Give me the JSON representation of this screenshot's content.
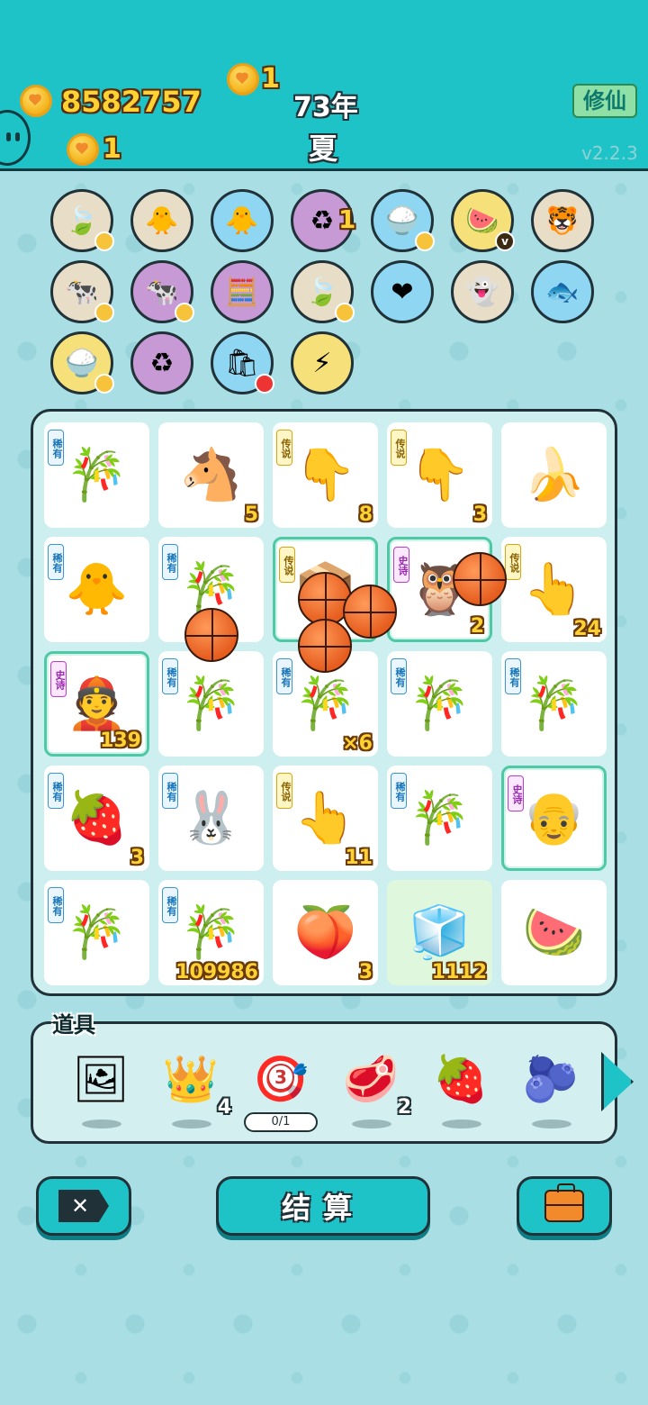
{
  "header": {
    "coins_total": "8582757",
    "coin_small_1": "1",
    "coin_small_2": "1",
    "year": "73年",
    "season": "夏",
    "xiuxian_label": "修仙",
    "version": "v2.2.3"
  },
  "skills": [
    {
      "name": "leaf-skill",
      "icon": "🍃",
      "bg": "#e8ddc6",
      "badge": "gold"
    },
    {
      "name": "chick-egg-skill",
      "icon": "🐥",
      "bg": "#e8ddc6",
      "badge": ""
    },
    {
      "name": "chick-egg-skill-2",
      "icon": "🐥",
      "bg": "#8fd6f2",
      "badge": ""
    },
    {
      "name": "recycle-coin-skill",
      "icon": "♻",
      "bg": "#c79ad6",
      "badge": "",
      "coin": "1"
    },
    {
      "name": "rice-bowl-skill",
      "icon": "🍚",
      "bg": "#8fd6f2",
      "badge": "gold"
    },
    {
      "name": "fruit-basket-skill",
      "icon": "🍉",
      "bg": "#f6e07a",
      "badge": "v"
    },
    {
      "name": "tiger-skill",
      "icon": "🐯",
      "bg": "#e8ddc6",
      "badge": ""
    },
    {
      "name": "cow-pair-skill",
      "icon": "🐄",
      "bg": "#e8ddc6",
      "badge": "gold"
    },
    {
      "name": "cow-pair-skill-2",
      "icon": "🐄",
      "bg": "#c79ad6",
      "badge": "gold"
    },
    {
      "name": "math-man-skill",
      "icon": "🧮",
      "bg": "#c79ad6",
      "badge": ""
    },
    {
      "name": "leaf-skill-2",
      "icon": "🍃",
      "bg": "#e8ddc6",
      "badge": "gold"
    },
    {
      "name": "heart-fan-skill",
      "icon": "❤",
      "bg": "#8fd6f2",
      "badge": ""
    },
    {
      "name": "ghost-skill",
      "icon": "👻",
      "bg": "#e8ddc6",
      "badge": ""
    },
    {
      "name": "fish-tank-skill",
      "icon": "🐟",
      "bg": "#8fd6f2",
      "badge": ""
    },
    {
      "name": "rice-bowl-skill-2",
      "icon": "🍚",
      "bg": "#f6e07a",
      "badge": "gold"
    },
    {
      "name": "recycle-skill",
      "icon": "♻",
      "bg": "#c79ad6",
      "badge": ""
    },
    {
      "name": "sack-skill",
      "icon": "🛍",
      "bg": "#8fd6f2",
      "badge": "red"
    },
    {
      "name": "lightning-skill",
      "icon": "⚡",
      "bg": "#f6e07a",
      "badge": ""
    }
  ],
  "board": [
    {
      "icon": "🎋",
      "tag": "稀有",
      "tagType": "rare",
      "count": ""
    },
    {
      "icon": "🐴",
      "tag": "",
      "tagType": "",
      "count": "5"
    },
    {
      "icon": "👇",
      "tag": "传说",
      "tagType": "legend",
      "count": "8"
    },
    {
      "icon": "👇",
      "tag": "传说",
      "tagType": "legend",
      "count": "3"
    },
    {
      "icon": "🍌",
      "tag": "",
      "tagType": "",
      "count": ""
    },
    {
      "icon": "🐥",
      "tag": "稀有",
      "tagType": "rare",
      "count": ""
    },
    {
      "icon": "🎋",
      "tag": "稀有",
      "tagType": "rare",
      "count": ""
    },
    {
      "icon": "📦",
      "tag": "传说",
      "tagType": "legend",
      "count": "",
      "hl": true
    },
    {
      "icon": "🦉",
      "tag": "史诗",
      "tagType": "epic",
      "count": "2",
      "hl": true
    },
    {
      "icon": "👆",
      "tag": "传说",
      "tagType": "legend",
      "count": "24"
    },
    {
      "icon": "👲",
      "tag": "史诗",
      "tagType": "epic",
      "count": "139",
      "hl": true
    },
    {
      "icon": "🎋",
      "tag": "稀有",
      "tagType": "rare",
      "count": ""
    },
    {
      "icon": "🎋",
      "tag": "稀有",
      "tagType": "rare",
      "count": "×6"
    },
    {
      "icon": "🎋",
      "tag": "稀有",
      "tagType": "rare",
      "count": ""
    },
    {
      "icon": "🎋",
      "tag": "稀有",
      "tagType": "rare",
      "count": ""
    },
    {
      "icon": "🍓",
      "tag": "稀有",
      "tagType": "rare",
      "count": "3"
    },
    {
      "icon": "🐰",
      "tag": "稀有",
      "tagType": "rare",
      "count": ""
    },
    {
      "icon": "👆",
      "tag": "传说",
      "tagType": "legend",
      "count": "11"
    },
    {
      "icon": "🎋",
      "tag": "稀有",
      "tagType": "rare",
      "count": ""
    },
    {
      "icon": "👴",
      "tag": "史诗",
      "tagType": "epic",
      "count": "",
      "hl": true
    },
    {
      "icon": "🎋",
      "tag": "稀有",
      "tagType": "rare",
      "count": ""
    },
    {
      "icon": "🎋",
      "tag": "稀有",
      "tagType": "rare",
      "count": "109986"
    },
    {
      "icon": "🍑",
      "tag": "",
      "tagType": "",
      "count": "3"
    },
    {
      "icon": "🧊",
      "tag": "",
      "tagType": "",
      "count": "1112",
      "green": true
    },
    {
      "icon": "🍉",
      "tag": "",
      "tagType": "",
      "count": ""
    }
  ],
  "items": {
    "title": "道具",
    "list": [
      {
        "name": "frame-item",
        "icon": "🖼",
        "qty": ""
      },
      {
        "name": "crown-item",
        "icon": "👑",
        "qty": "4"
      },
      {
        "name": "target-item",
        "icon": "🎯",
        "qty": "",
        "progress": "0/1",
        "level": "3"
      },
      {
        "name": "liver-item",
        "icon": "🥩",
        "qty": "2"
      },
      {
        "name": "strawberry-item",
        "icon": "🍓",
        "qty": ""
      },
      {
        "name": "blueberry-item",
        "icon": "🫐",
        "qty": ""
      }
    ]
  },
  "buttons": {
    "settle_label": "结算"
  }
}
